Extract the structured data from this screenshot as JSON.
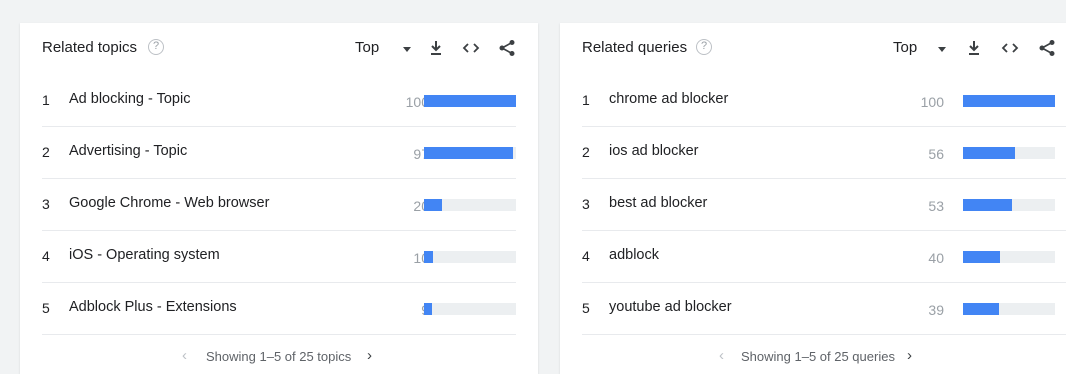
{
  "colors": {
    "bar": "#4285f4",
    "track": "#eceff1"
  },
  "topics": {
    "title": "Related topics",
    "help": "?",
    "filter": "Top",
    "icons": [
      "download-icon",
      "embed-icon",
      "share-icon"
    ],
    "rows": [
      {
        "rank": "1",
        "label": "Ad blocking - Topic",
        "value": "100"
      },
      {
        "rank": "2",
        "label": "Advertising - Topic",
        "value": "97"
      },
      {
        "rank": "3",
        "label": "Google Chrome - Web browser",
        "value": "20"
      },
      {
        "rank": "4",
        "label": "iOS - Operating system",
        "value": "10"
      },
      {
        "rank": "5",
        "label": "Adblock Plus - Extensions",
        "value": "9"
      }
    ],
    "pager": {
      "prev": "‹",
      "text": "Showing 1–5 of 25 topics",
      "next": "›"
    }
  },
  "queries": {
    "title": "Related queries",
    "help": "?",
    "filter": "Top",
    "icons": [
      "download-icon",
      "embed-icon",
      "share-icon"
    ],
    "rows": [
      {
        "rank": "1",
        "label": "chrome ad blocker",
        "value": "100"
      },
      {
        "rank": "2",
        "label": "ios ad blocker",
        "value": "56"
      },
      {
        "rank": "3",
        "label": "best ad blocker",
        "value": "53"
      },
      {
        "rank": "4",
        "label": "adblock",
        "value": "40"
      },
      {
        "rank": "5",
        "label": "youtube ad blocker",
        "value": "39"
      }
    ],
    "pager": {
      "prev": "‹",
      "text": "Showing 1–5 of 25 queries",
      "next": "›"
    }
  }
}
